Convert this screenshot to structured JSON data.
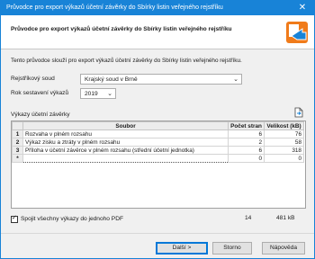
{
  "window": {
    "title": "Průvodce pro export výkazů účetní závěrky do Sbírky listin veřejného rejstříku",
    "close_glyph": "✕"
  },
  "header": {
    "heading": "Průvodce pro export výkazů účetní závěrky do Sbírky listin veřejného rejstříku",
    "logo_icon": "export-wizard-logo-icon"
  },
  "intro_text": "Tento průvodce slouží pro export výkazů účetní závěrky do Sbírky listin veřejného rejstříku.",
  "form": {
    "court_label": "Rejstříkový soud",
    "court_value": "Krajský soud v Brně",
    "year_label": "Rok sestavení výkazů",
    "year_value": "2019"
  },
  "reports": {
    "section_label": "Výkazy účetní závěrky",
    "columns": {
      "file": "Soubor",
      "pages": "Počet stran",
      "size": "Velikost (kB)"
    },
    "rows": [
      {
        "index": "1",
        "file": "Rozvaha v plném rozsahu",
        "pages": "6",
        "size": "76"
      },
      {
        "index": "2",
        "file": "Výkaz zisku a ztráty v plném rozsahu",
        "pages": "2",
        "size": "58"
      },
      {
        "index": "3",
        "file": "Příloha v účetní závěrce v plném rozsahu (střední účetní jednotka)",
        "pages": "6",
        "size": "318"
      },
      {
        "index": "*",
        "file": "",
        "pages": "0",
        "size": "0"
      }
    ]
  },
  "merge_checkbox": {
    "label": "Spojit všechny výkazy do jednoho PDF",
    "checked_glyph": "✓"
  },
  "totals": {
    "pages": "14",
    "size": "481 kB"
  },
  "buttons": {
    "next": "Další >",
    "cancel": "Storno",
    "help": "Nápověda"
  },
  "colors": {
    "titlebar": "#1883d7",
    "logo_orange": "#f07b1a",
    "logo_blue": "#1883d7"
  }
}
